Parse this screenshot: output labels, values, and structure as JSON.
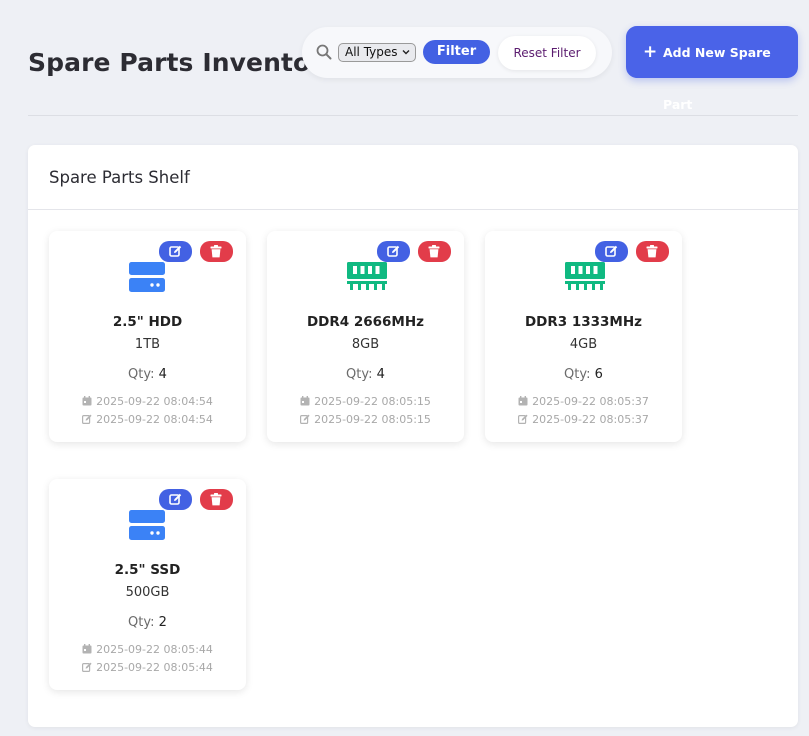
{
  "page": {
    "title": "Spare Parts Inventory"
  },
  "filter": {
    "search_icon": "search-icon",
    "type_select_value": "All Types",
    "filter_label": "Filter",
    "reset_label": "Reset Filter"
  },
  "toolbar": {
    "add_label": "Add New Spare Part",
    "add_icon": "plus-icon"
  },
  "shelf": {
    "title": "Spare Parts Shelf",
    "qty_label": "Qty:",
    "parts": [
      {
        "icon": "hdd-icon",
        "icon_color": "#3b82f6",
        "name": "2.5\" HDD",
        "capacity": "1TB",
        "qty": "4",
        "created": "2025-09-22 08:04:54",
        "updated": "2025-09-22 08:04:54"
      },
      {
        "icon": "memory-icon",
        "icon_color": "#10b981",
        "name": "DDR4 2666MHz",
        "capacity": "8GB",
        "qty": "4",
        "created": "2025-09-22 08:05:15",
        "updated": "2025-09-22 08:05:15"
      },
      {
        "icon": "memory-icon",
        "icon_color": "#10b981",
        "name": "DDR3 1333MHz",
        "capacity": "4GB",
        "qty": "6",
        "created": "2025-09-22 08:05:37",
        "updated": "2025-09-22 08:05:37"
      },
      {
        "icon": "hdd-icon",
        "icon_color": "#3b82f6",
        "name": "2.5\" SSD",
        "capacity": "500GB",
        "qty": "2",
        "created": "2025-09-22 08:05:44",
        "updated": "2025-09-22 08:05:44"
      }
    ]
  },
  "colors": {
    "accent": "#4361e3",
    "danger": "#e23c4a",
    "hdd": "#3b82f6",
    "memory": "#10b981"
  }
}
